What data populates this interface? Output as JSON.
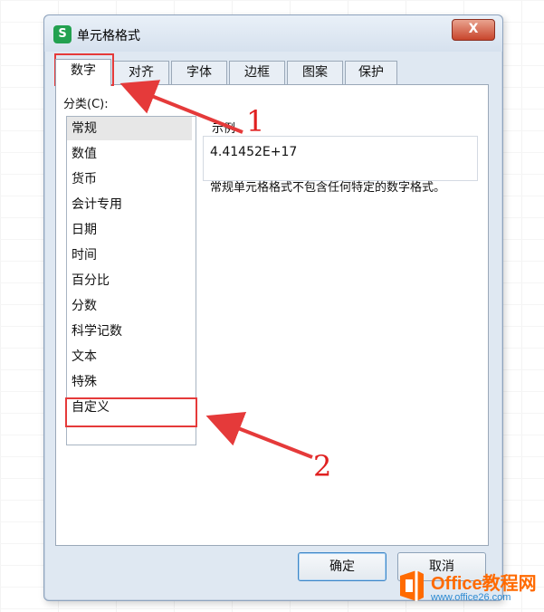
{
  "window": {
    "title": "单元格格式",
    "app_icon": "S",
    "close_label": "X"
  },
  "tabs": [
    {
      "label": "数字",
      "active": true
    },
    {
      "label": "对齐"
    },
    {
      "label": "字体"
    },
    {
      "label": "边框"
    },
    {
      "label": "图案"
    },
    {
      "label": "保护"
    }
  ],
  "category": {
    "label": "分类(C):",
    "items": [
      "常规",
      "数值",
      "货币",
      "会计专用",
      "日期",
      "时间",
      "百分比",
      "分数",
      "科学记数",
      "文本",
      "特殊",
      "自定义"
    ],
    "selected": "常规"
  },
  "sample": {
    "label": "示例",
    "value": "4.41452E+17"
  },
  "description": "常规单元格格式不包含任何特定的数字格式。",
  "buttons": {
    "ok": "确定",
    "cancel": "取消"
  },
  "annotations": {
    "num1": "1",
    "num2": "2",
    "color": "#e53a3a"
  },
  "watermark": {
    "brand": "Office教程网",
    "url": "www.office26.com"
  }
}
